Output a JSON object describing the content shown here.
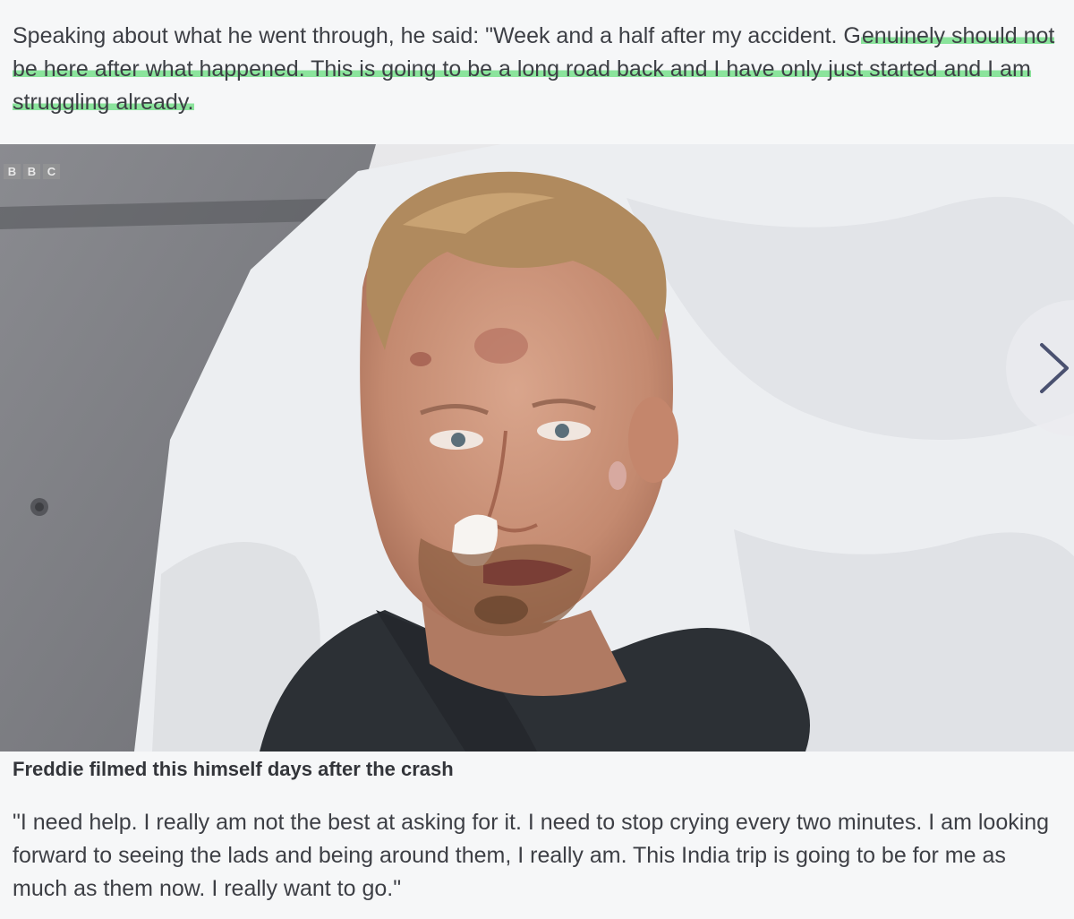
{
  "article": {
    "intro_text": "Speaking about what he went through, he said: \"Week and a half after my accident. G",
    "highlight_text": "enuinely should not be here after what happened. This is going to be a long road back and I have only just started and I am struggling already.",
    "caption": "Freddie filmed this himself days after the crash",
    "quote": "\"I need help. I really am not the best at asking for it. I need to stop crying every two minutes. I am looking forward to seeing the lads and being around them, I really am. This India trip is going to be for me as much as them now. I really want to go.\""
  },
  "photo": {
    "watermark": [
      "B",
      "B",
      "C"
    ],
    "next_icon": "chevron-right-icon"
  },
  "colors": {
    "highlight": "#78e08c",
    "text": "#3d3f45",
    "background": "#f6f7f8"
  }
}
